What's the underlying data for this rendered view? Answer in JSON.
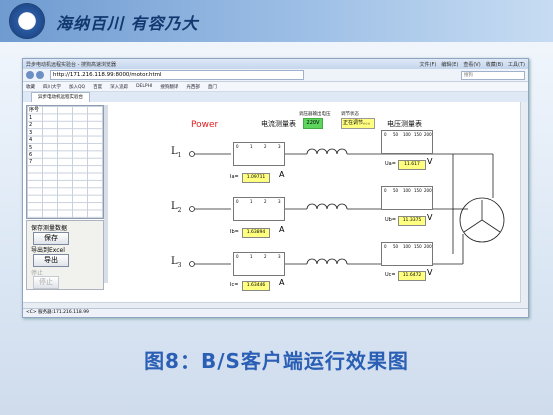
{
  "slide": {
    "motto": "海纳百川  有容乃大",
    "caption": "图8：B/S客户端运行效果图"
  },
  "browser": {
    "title": "异步电动机远程实验台 - 搜狗高速浏览器",
    "menu": [
      "文件(F)",
      "编辑(E)",
      "查看(V)",
      "收藏(B)",
      "工具(T)"
    ],
    "url": "http://171.216.118.99:8000/motor.html",
    "search_placeholder": "搜狗",
    "favorites": [
      "收藏",
      "四川大学",
      "加入QQ",
      "百度",
      "深入追踪",
      "DELPHI",
      "搜狗翻译",
      "光西部",
      "直门"
    ],
    "tab": "异步电动机远程实验台",
    "status": "<C> 服务器:171.216.118.99"
  },
  "panel": {
    "grid_header": "序号",
    "row_numbers": [
      "1",
      "2",
      "3",
      "4",
      "5",
      "6",
      "7"
    ],
    "save_label": "保存测量数据",
    "save_button": "保存",
    "export_label": "导出到Excel",
    "export_button": "导出",
    "stop_label": "停止",
    "stop_button": "停止"
  },
  "main": {
    "power": "Power",
    "current_title": "电流测量表",
    "voltage_title": "电压测量表",
    "regulator_label": "调压器输出电压",
    "regulator_value": "220V",
    "adjust_label": "调节状态",
    "adjust_value": "正在调节。。。",
    "lines": [
      {
        "label": "L",
        "sub": "1",
        "cur_name": "Ia=",
        "cur_val": "1.09711",
        "volt_name": "Ua=",
        "volt_val": "11.617"
      },
      {
        "label": "L",
        "sub": "2",
        "cur_name": "Ib=",
        "cur_val": "1.63894",
        "volt_name": "Ub=",
        "volt_val": "11.3375"
      },
      {
        "label": "L",
        "sub": "3",
        "cur_name": "Ic=",
        "cur_val": "1.63446",
        "volt_name": "Uc=",
        "volt_val": "11.6472"
      }
    ],
    "current_unit": "A",
    "voltage_unit": "V",
    "ammeter_scale": [
      "0",
      "1",
      "2",
      "3"
    ],
    "voltmeter_scale": [
      "0",
      "50",
      "100",
      "150",
      "200"
    ]
  }
}
